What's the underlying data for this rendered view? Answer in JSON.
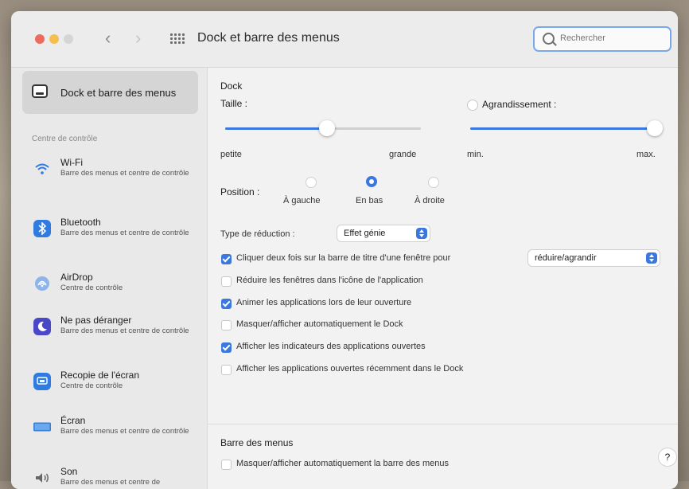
{
  "window": {
    "title": "Dock et barre des menus",
    "search_placeholder": "Rechercher"
  },
  "sidebar": {
    "selected": {
      "label": "Dock et barre des menus"
    },
    "section_header": "Centre de contrôle",
    "items": [
      {
        "name": "Wi-Fi",
        "sub": "Barre des menus et centre de contrôle",
        "icon": "wifi-icon"
      },
      {
        "name": "Bluetooth",
        "sub": "Barre des menus et centre de contrôle",
        "icon": "bluetooth-icon"
      },
      {
        "name": "AirDrop",
        "sub": "Centre de contrôle",
        "icon": "airdrop-icon"
      },
      {
        "name": "Ne pas déranger",
        "sub": "Barre des menus et centre de contrôle",
        "icon": "moon-icon"
      },
      {
        "name": "Recopie de l'écran",
        "sub": "Centre de contrôle",
        "icon": "screen-mirroring-icon"
      },
      {
        "name": "Écran",
        "sub": "Barre des menus et centre de contrôle",
        "icon": "display-icon"
      },
      {
        "name": "Son",
        "sub": "Barre des menus et centre de",
        "icon": "sound-icon"
      }
    ]
  },
  "dock": {
    "heading": "Dock",
    "size_label": "Taille :",
    "size_value": 0.52,
    "size_min_label": "petite",
    "size_max_label": "grande",
    "magnification_label": "Agrandissement :",
    "magnification_checked": false,
    "magnification_value": 1.0,
    "mag_min_label": "min.",
    "mag_max_label": "max.",
    "position_label": "Position :",
    "positions": [
      "À gauche",
      "En bas",
      "À droite"
    ],
    "position_selected": "En bas",
    "minimize_label": "Type de réduction :",
    "minimize_value": "Effet génie",
    "double_click_label": "Cliquer deux fois sur la barre de titre d'une fenêtre pour",
    "double_click_checked": true,
    "double_click_value": "réduire/agrandir",
    "minimize_into_app_label": "Réduire les fenêtres dans l'icône de l'application",
    "minimize_into_app_checked": false,
    "animate_label": "Animer les applications lors de leur ouverture",
    "animate_checked": true,
    "autohide_label": "Masquer/afficher automatiquement le Dock",
    "autohide_checked": false,
    "indicators_label": "Afficher les indicateurs des applications ouvertes",
    "indicators_checked": true,
    "recent_label": "Afficher les applications ouvertes récemment dans le Dock",
    "recent_checked": false
  },
  "menubar": {
    "heading": "Barre des menus",
    "autohide_label": "Masquer/afficher automatiquement la barre des menus",
    "autohide_checked": false
  },
  "help_label": "?",
  "colors": {
    "accent": "#3a78e0"
  }
}
